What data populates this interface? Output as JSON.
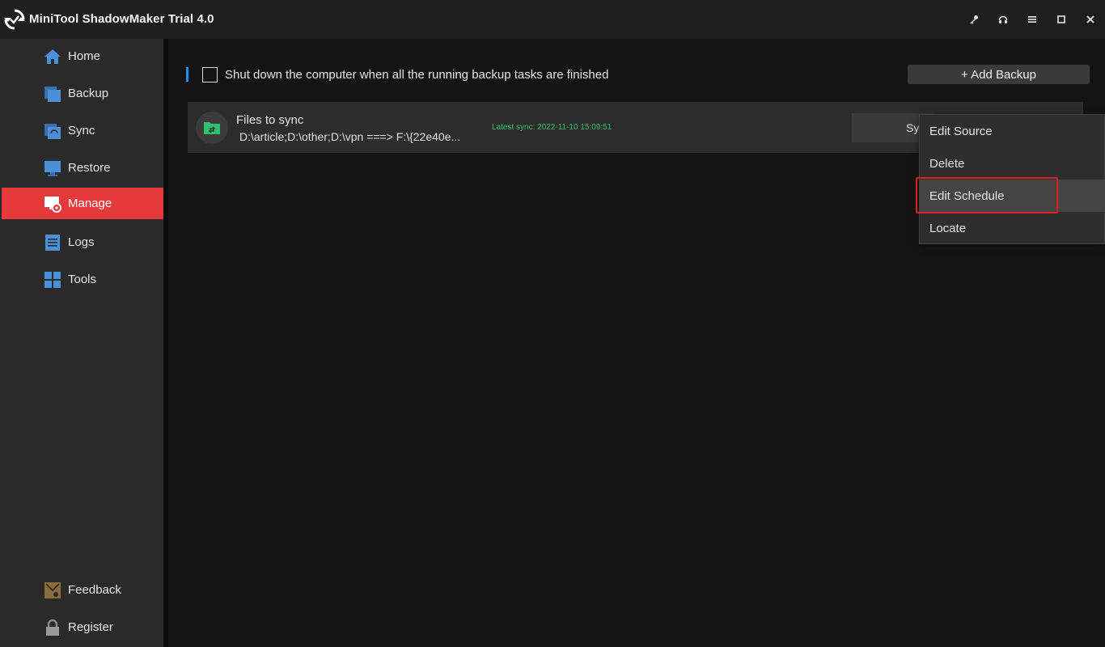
{
  "app": {
    "title": "MiniTool ShadowMaker Trial 4.0"
  },
  "window_controls": [
    "key-icon",
    "headset-icon",
    "menu-icon",
    "maximize-icon",
    "close-icon"
  ],
  "sidebar": {
    "items": [
      {
        "label": "Home",
        "icon": "home-icon"
      },
      {
        "label": "Backup",
        "icon": "backup-icon"
      },
      {
        "label": "Sync",
        "icon": "sync-icon"
      },
      {
        "label": "Restore",
        "icon": "restore-icon"
      },
      {
        "label": "Manage",
        "icon": "manage-icon",
        "active": true
      },
      {
        "label": "Logs",
        "icon": "logs-icon"
      },
      {
        "label": "Tools",
        "icon": "tools-icon"
      }
    ],
    "bottom": [
      {
        "label": "Feedback",
        "icon": "feedback-icon"
      },
      {
        "label": "Register",
        "icon": "lock-icon"
      }
    ]
  },
  "toolbar": {
    "shutdown_label": "Shut down the computer when all the running backup tasks are finished",
    "shutdown_checked": false,
    "add_backup_label": "+ Add Backup"
  },
  "task": {
    "name": "Files to sync",
    "path": "D:\\article;D:\\other;D:\\vpn ===> F:\\{22e40e...",
    "latest_sync": "Latest sync: 2022-11-10 15:09:51",
    "sync_button_label": "Sy",
    "icon": "folder-sync-icon"
  },
  "context_menu": {
    "items": [
      "Edit Source",
      "Delete",
      "Edit Schedule",
      "Locate"
    ],
    "hovered": "Edit Schedule"
  },
  "colors": {
    "accent": "#e5393a",
    "highlight": "#e02020",
    "sync_green": "#2fbf71",
    "info_blue": "#1e90ff"
  }
}
